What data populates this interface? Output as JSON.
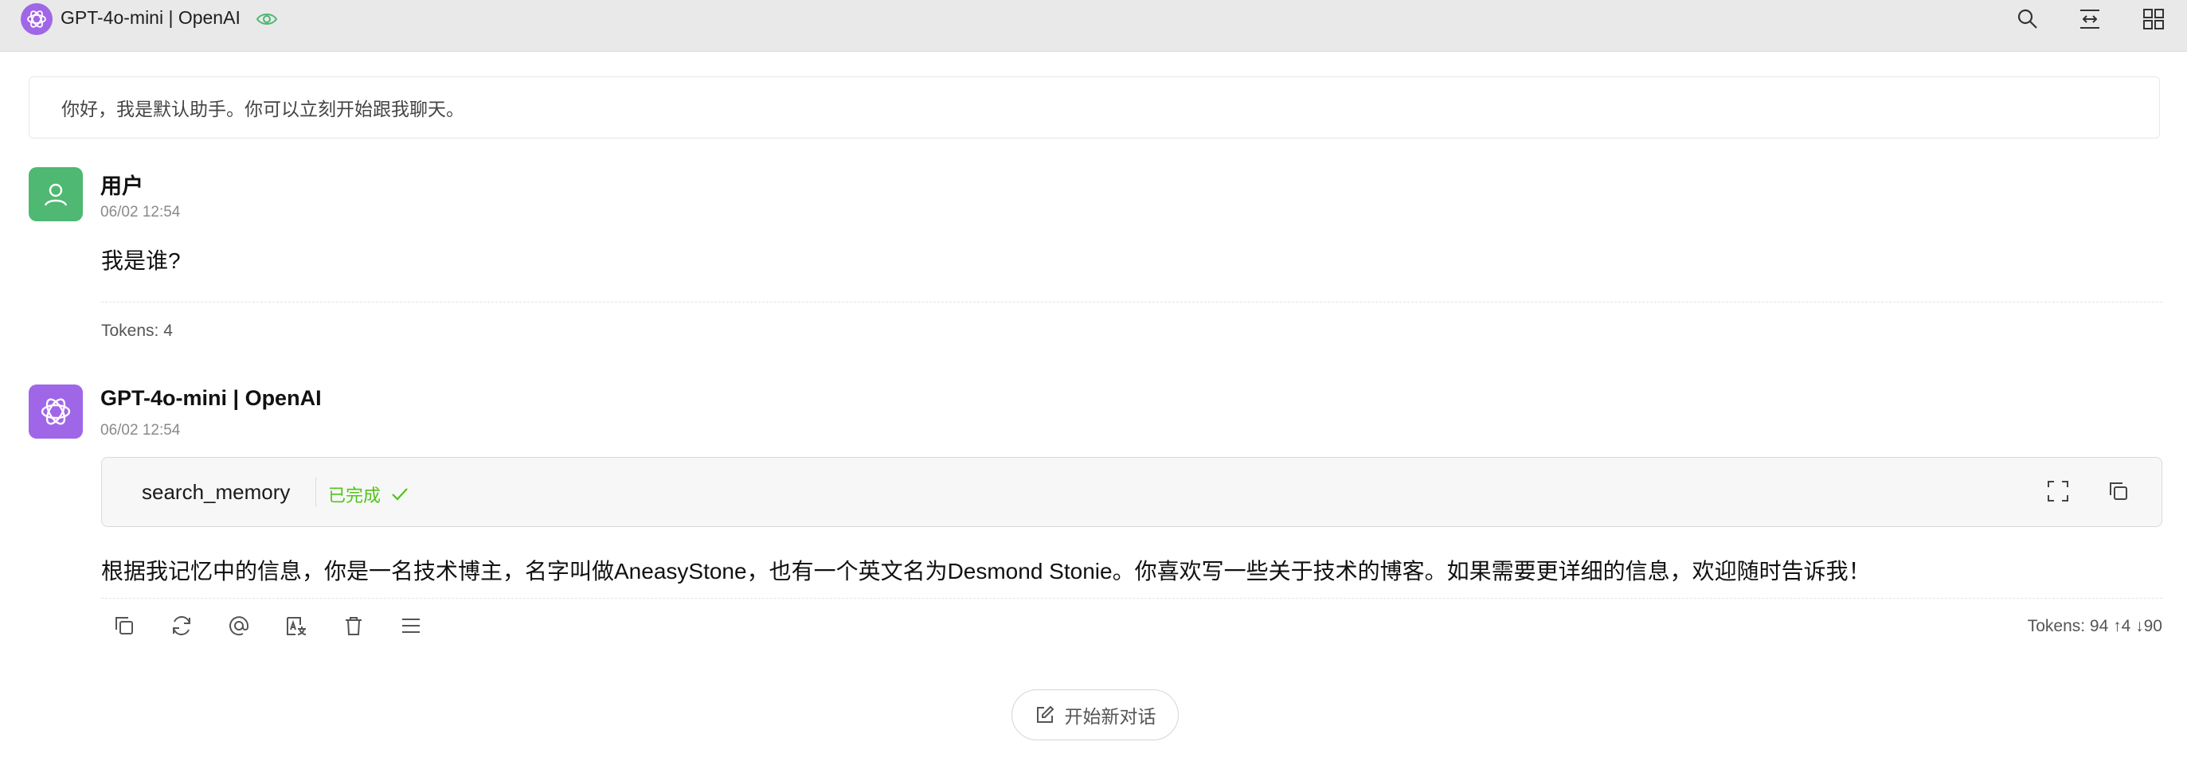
{
  "header": {
    "title": "GPT-4o-mini | OpenAI",
    "icons": [
      "openai-logo",
      "eye-icon",
      "search-icon",
      "swap-icon",
      "grid-icon"
    ]
  },
  "welcome": {
    "text": "你好，我是默认助手。你可以立刻开始跟我聊天。"
  },
  "messages": [
    {
      "role": "user",
      "name": "用户",
      "time": "06/02 12:54",
      "content": "我是谁?",
      "tokens": "Tokens: 4"
    },
    {
      "role": "assistant",
      "name": "GPT-4o-mini | OpenAI",
      "time": "06/02 12:54",
      "tool": {
        "name": "search_memory",
        "status": "已完成"
      },
      "content": "根据我记忆中的信息，你是一名技术博主，名字叫做AneasyStone，也有一个英文名为Desmond Stonie。你喜欢写一些关于技术的博客。如果需要更详细的信息，欢迎随时告诉我！",
      "tokens": "Tokens: 94 ↑4 ↓90"
    }
  ],
  "actions": [
    "copy-icon",
    "regenerate-icon",
    "mention-icon",
    "translate-icon",
    "delete-icon",
    "menu-icon"
  ],
  "new_chat": {
    "label": "开始新对话"
  },
  "colors": {
    "accent_purple": "#a066e8",
    "user_green": "#4fb872",
    "success_green": "#52c41a",
    "topbar_bg": "#e9e9e9"
  }
}
